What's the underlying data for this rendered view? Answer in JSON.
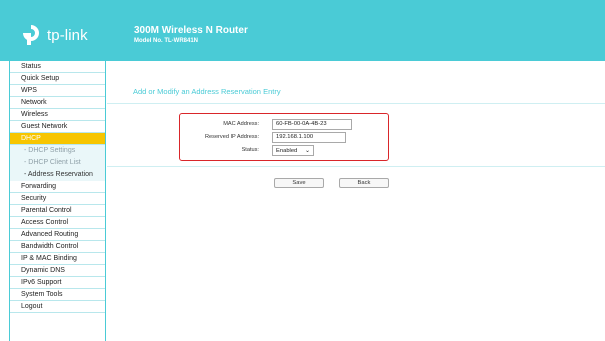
{
  "header": {
    "logo_text": "tp-link",
    "product_title": "300M Wireless N Router",
    "model": "Model No. TL-WR841N"
  },
  "sidebar": {
    "items": [
      {
        "label": "Status"
      },
      {
        "label": "Quick Setup"
      },
      {
        "label": "WPS"
      },
      {
        "label": "Network"
      },
      {
        "label": "Wireless"
      },
      {
        "label": "Guest Network"
      },
      {
        "label": "DHCP",
        "active": true
      },
      {
        "label": "- DHCP Settings",
        "sub": true
      },
      {
        "label": "- DHCP Client List",
        "sub": true
      },
      {
        "label": "- Address Reservation",
        "sub": true,
        "current": true
      },
      {
        "label": "Forwarding"
      },
      {
        "label": "Security"
      },
      {
        "label": "Parental Control"
      },
      {
        "label": "Access Control"
      },
      {
        "label": "Advanced Routing"
      },
      {
        "label": "Bandwidth Control"
      },
      {
        "label": "IP & MAC Binding"
      },
      {
        "label": "Dynamic DNS"
      },
      {
        "label": "IPv6 Support"
      },
      {
        "label": "System Tools"
      },
      {
        "label": "Logout"
      }
    ]
  },
  "main": {
    "title": "Add or Modify an Address Reservation Entry",
    "form": {
      "mac_label": "MAC Address:",
      "mac_value": "60-FB-00-0A-4B-23",
      "ip_label": "Reserved IP Address:",
      "ip_value": "192.168.1.100",
      "status_label": "Status:",
      "status_value": "Enabled"
    },
    "buttons": {
      "save": "Save",
      "back": "Back"
    }
  },
  "colors": {
    "accent": "#4acbd6",
    "active": "#f7c500",
    "highlight": "#d9262a"
  }
}
